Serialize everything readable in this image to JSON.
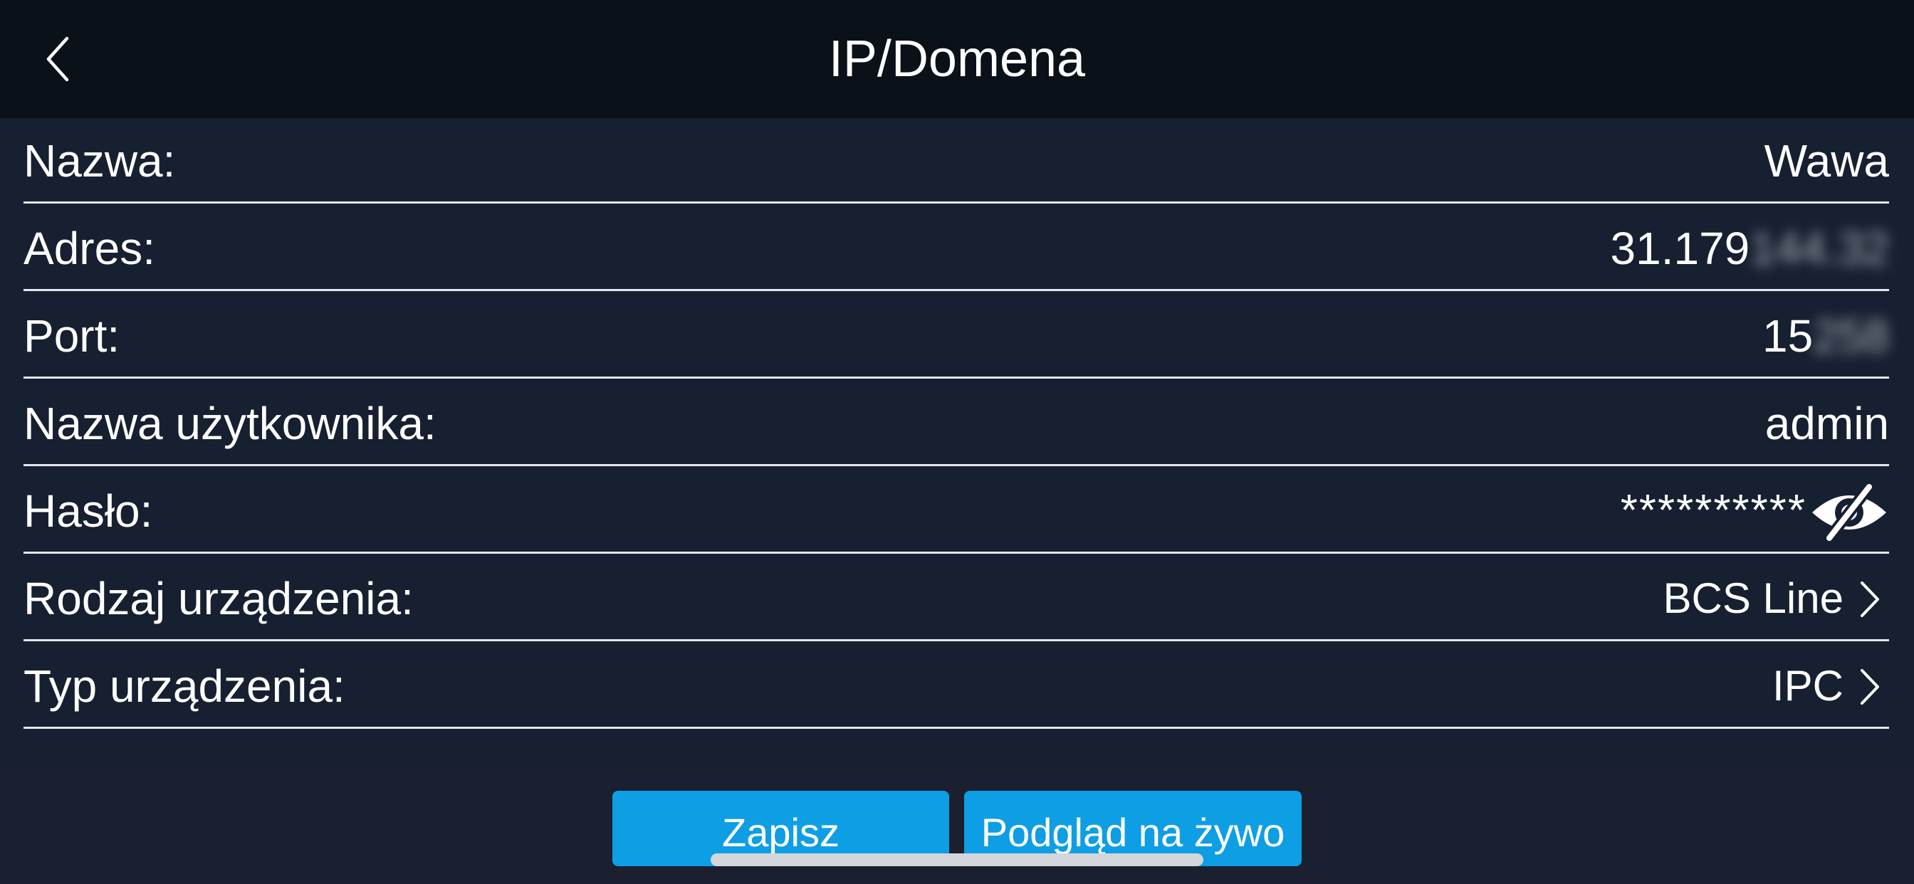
{
  "header": {
    "title": "IP/Domena",
    "back_icon": "chevron-left-icon"
  },
  "form": {
    "name": {
      "label": "Nazwa:",
      "value": "Wawa"
    },
    "address": {
      "label": "Adres:",
      "value_visible": "31.179",
      "value_obscured": "144.32"
    },
    "port": {
      "label": "Port:",
      "value_visible": "15",
      "value_obscured": "258"
    },
    "username": {
      "label": "Nazwa użytkownika:",
      "value": "admin"
    },
    "password": {
      "label": "Hasło:",
      "value": "**********",
      "toggle_icon": "eye-slash-icon"
    },
    "device_kind": {
      "label": "Rodzaj urządzenia:",
      "value": "BCS Line"
    },
    "device_type": {
      "label": "Typ urządzenia:",
      "value": "IPC"
    }
  },
  "actions": {
    "save_label": "Zapisz",
    "live_label": "Podgląd na żywo"
  },
  "colors": {
    "navbar_bg": "#0b1119",
    "form_bg": "#162030",
    "page_bg": "#1b2030",
    "accent": "#0e9ee4",
    "divider": "#e4e7ec"
  }
}
